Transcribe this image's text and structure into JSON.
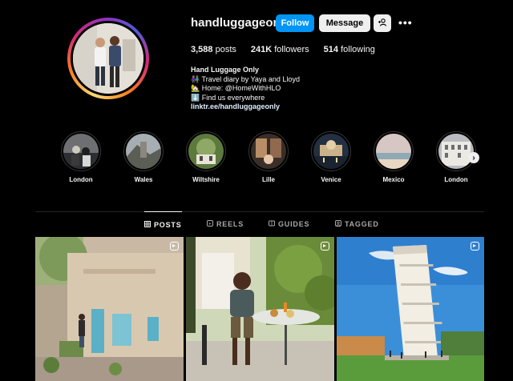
{
  "profile": {
    "username": "handluggageonly",
    "follow_label": "Follow",
    "message_label": "Message",
    "add_user_icon": "add-person",
    "more_icon": "more-horizontal",
    "more_label": "•••",
    "stats": {
      "posts_count": "3,588",
      "posts_label": "posts",
      "followers_count": "241K",
      "followers_label": "followers",
      "following_count": "514",
      "following_label": "following"
    },
    "bio": {
      "name": "Hand Luggage Only",
      "line1": "👫🏽 Travel diary by Yaya and Lloyd",
      "line2": "🏡 Home: @HomeWithHLO",
      "line3": "⬇️ Find us everywhere",
      "link": "linktr.ee/handluggageonly"
    }
  },
  "highlights": [
    {
      "label": "London"
    },
    {
      "label": "Wales"
    },
    {
      "label": "Wiltshire"
    },
    {
      "label": "Lille"
    },
    {
      "label": "Venice"
    },
    {
      "label": "Mexico"
    },
    {
      "label": "London"
    }
  ],
  "highlights_next_icon": "›",
  "tabs": [
    {
      "label": "POSTS",
      "icon": "grid-icon",
      "active": true
    },
    {
      "label": "REELS",
      "icon": "reels-icon",
      "active": false
    },
    {
      "label": "GUIDES",
      "icon": "guides-icon",
      "active": false
    },
    {
      "label": "TAGGED",
      "icon": "tagged-icon",
      "active": false
    }
  ],
  "posts": [
    {
      "type": "reel",
      "subject": "stone-house-street"
    },
    {
      "type": "reel",
      "subject": "man-at-breakfast-table"
    },
    {
      "type": "reel",
      "subject": "leaning-tower-of-pisa"
    }
  ],
  "colors": {
    "background": "#000000",
    "follow_button": "#0095f6",
    "secondary_button": "#efefef",
    "muted_text": "#a8a8a8",
    "link_text": "#e0f1ff"
  }
}
